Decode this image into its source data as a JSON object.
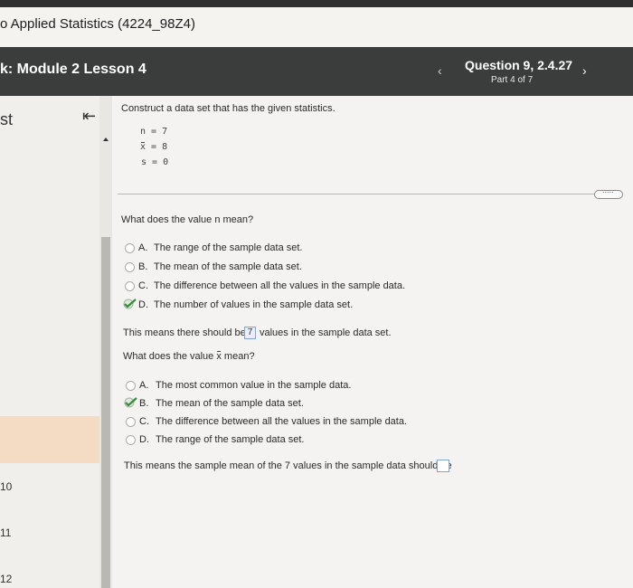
{
  "course": {
    "title": "o Applied Statistics (4224_98Z4)"
  },
  "module": {
    "title": "k: Module 2 Lesson 4",
    "prev": "‹",
    "next": "›"
  },
  "question": {
    "label": "Question 9, 2.4.27",
    "part": "Part 4 of 7"
  },
  "sidebar": {
    "partial_label": "st",
    "numbers": [
      "10",
      "11",
      "12"
    ],
    "collapse_icon": "collapse-left-icon"
  },
  "problem": {
    "prompt": "Construct a data set that has the given statistics.",
    "stats": {
      "n": "n = 7",
      "xbar_rest": " = 8",
      "s": "s = 0"
    },
    "more_label": "....."
  },
  "q1": {
    "prompt": "What does the value n mean?",
    "options": [
      {
        "letter": "A.",
        "text": "The range of the sample data set."
      },
      {
        "letter": "B.",
        "text": "The mean of the sample data set."
      },
      {
        "letter": "C.",
        "text": "The difference between all the values in the sample data."
      },
      {
        "letter": "D.",
        "text": "The number of values in the sample data set."
      }
    ],
    "selected": "D",
    "result_before": "This means there should be",
    "result_value": "7",
    "result_after": "values in the sample data set."
  },
  "q2": {
    "prompt_before": "What does the value",
    "prompt_after": "mean?",
    "options": [
      {
        "letter": "A.",
        "text": "The most common value in the sample data."
      },
      {
        "letter": "B.",
        "text": "The mean of the sample data set."
      },
      {
        "letter": "C.",
        "text": "The difference between all the values in the sample data."
      },
      {
        "letter": "D.",
        "text": "The range of the sample data set."
      }
    ],
    "selected": "B",
    "result_text": "This means the sample mean of the 7 values in the sample data should be"
  },
  "colors": {
    "header_dark": "#3b3d3c",
    "highlight_band": "#f3dcc3",
    "check_green": "#3a8a3a"
  }
}
